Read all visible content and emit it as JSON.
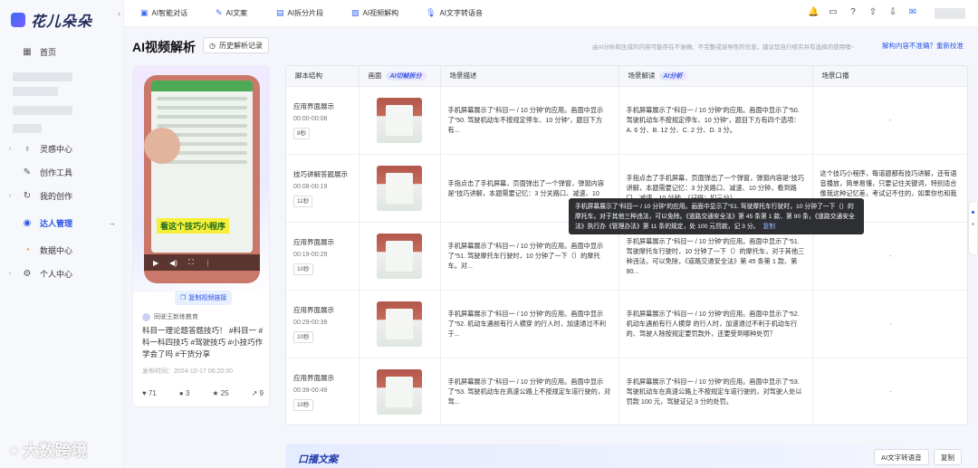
{
  "sidebar": {
    "logo": "花儿朵朵",
    "items": [
      {
        "label": "首页"
      },
      {
        "label": "灵感中心"
      },
      {
        "label": "创作工具"
      },
      {
        "label": "我的创作"
      },
      {
        "label": "达人管理"
      },
      {
        "label": "数据中心"
      },
      {
        "label": "个人中心"
      }
    ]
  },
  "topbar": {
    "tabs": [
      "AI智能对话",
      "AI文案",
      "AI拆分片段",
      "AI视频解构",
      "AI文字转语音"
    ]
  },
  "header": {
    "title": "AI视频解析",
    "history_label": "历史解析记录",
    "disclaimer": "由AI分析和生成的内容可能存在不准确、不完整或误导性的信息，建议您自行核实并有选择的使用噢~",
    "inaccurate_label": "解构内容不准确？重新校准"
  },
  "video": {
    "caption": "看这个技巧小程序",
    "copy_link": "复制视频链接",
    "author": "同驶王新练教育",
    "description": "科目一理论题答题技巧！ #科目一 #科一科四技巧 #驾驶技巧 #小技巧作学会了吗 #干货分享",
    "publish_time": "发布时间：2024-10-17 06:20:00",
    "stats": {
      "likes": "71",
      "comments": "3",
      "favorites": "25",
      "shares": "9"
    }
  },
  "table": {
    "headers": {
      "script": "脚本结构",
      "frame": "画面",
      "frame_badge": "AI切帧拆分",
      "scene": "场景描述",
      "analysis": "场景解读",
      "analysis_badge": "AI分析",
      "voice": "场景口播"
    },
    "rows": [
      {
        "title": "应用界面展示",
        "time": "00:00-00:08",
        "duration": "8秒",
        "scene": "手机屏幕展示了“科目一 / 10 分钟”的应用。画面中显示了“50. 驾驶机动车不按规定停车、10 分钟”，题目下方有...",
        "analysis": "手机屏幕展示了“科目一 / 10 分钟”的应用。画面中显示了“50. 驾驶机动车不按规定停车、10 分钟”，题目下方有四个选项：A. 6 分、B. 12 分、C. 2 分、D. 3 分。",
        "voice": "-"
      },
      {
        "title": "技巧讲解答题展示",
        "time": "00:08-00:19",
        "duration": "11秒",
        "scene": "手指点击了手机屏幕，页面弹出了一个弹窗，弹窗内容是“技巧讲解，本题需要记忆：3 分关路口、减速、10",
        "analysis": "手指点击了手机屏幕，页面弹出了一个弹窗，弹窗内容是“技巧讲解，本题需要记忆：3 分关路口、减速、10 分钟，看到路口、减速、10 分钟。（记得：扣三分）",
        "voice": "这个技巧小程序，每道题都有技巧讲解，还有语音播放，简单易懂，只要记住关键词，特别适合像我这种记忆差，考试记不住的，如果你也和我一样..."
      },
      {
        "title": "应用界面展示",
        "time": "00:19-00:29",
        "duration": "10秒",
        "scene": "手机屏幕展示了“科目一 / 10 分钟”的应用。画面中显示了“51. 驾驶摩托车行驶时，10 分钟了一下（）的摩托车。对...",
        "analysis": "手机屏幕展示了“科目一 / 10 分钟”的应用。画面中显示了“51. 驾驶摩托车行驶时，10 分钟了一下（）的摩托车，对于其他三种违法，可以免除，《道路交通安全法》第 45 条第 1 款、第 90...",
        "voice": "-"
      },
      {
        "title": "应用界面展示",
        "time": "00:29-00:39",
        "duration": "10秒",
        "scene": "手机屏幕展示了“科目一 / 10 分钟”的应用。画面中显示了“52. 机动车遇前有行人横穿 的行人时，加速通过不利于...",
        "analysis": "手机屏幕展示了“科目一 / 10 分钟”的应用。画面中显示了“52. 机动车遇前有行人横穿 的行人时，加速通过不利于机动车行的、驾驶人除按规定要罚款外，还要受到哪种处罚？",
        "voice": "-"
      },
      {
        "title": "应用界面展示",
        "time": "00:39-00:49",
        "duration": "10秒",
        "scene": "手机屏幕展示了“科目一 / 10 分钟”的应用。画面中显示了“53. 驾驶机动车在高速公路上不按规定车道行驶的，对驾...",
        "analysis": "手机屏幕展示了“科目一 / 10 分钟”的应用。画面中显示了“53. 驾驶机动车在高速公路上不按规定车道行驶的，对驾驶人处以罚款 100 元，驾驶证记 3 分的处罚。",
        "voice": "-"
      }
    ]
  },
  "tooltip": {
    "text": "手机屏幕展示了“科目一 / 10 分钟”的应用。画面中显示了“51. 驾驶摩托车行驶时，10 分钟了一下（）的摩托车。对于其他三种违法，可以免除。《道路交通安全法》第 45 条第 1 款、第 90 条，《道路交通安全法》执行办《管理办法》第 11 条的规定，处 100 元罚款，记 3 分。",
    "copy": "复制"
  },
  "bottom": {
    "title": "口播文案",
    "tts_label": "AI文字转语音",
    "copy_label": "复制"
  },
  "watermark": "大数跨境"
}
